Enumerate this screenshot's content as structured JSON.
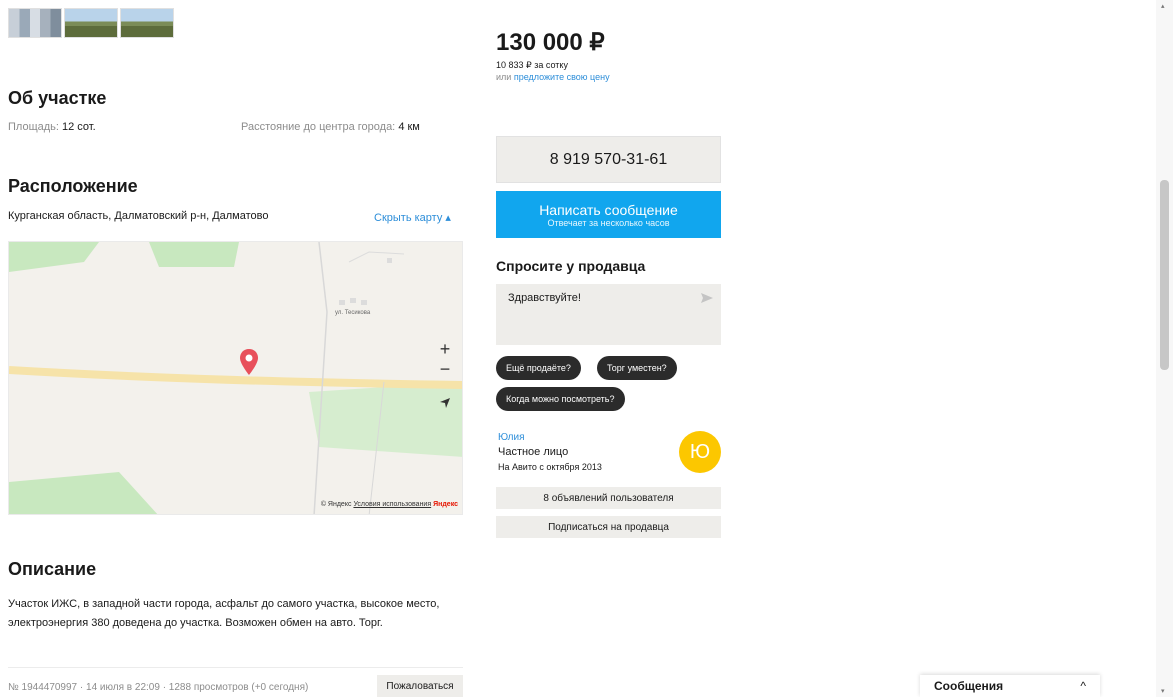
{
  "gallery": {
    "thumbnails": [
      "thumb-1",
      "thumb-2",
      "thumb-3"
    ]
  },
  "about": {
    "title": "Об участке",
    "area_label": "Площадь:",
    "area_value": "12 сот.",
    "distance_label": "Расстояние до центра города:",
    "distance_value": "4 км"
  },
  "location": {
    "title": "Расположение",
    "address": "Курганская область, Далматовский р-н, Далматово",
    "toggle_map": "Скрыть карту ▴",
    "map": {
      "street_label": "ул. Тесикова",
      "copyright": "© Яндекс",
      "terms": "Условия использования",
      "brand": "Яндекс",
      "zoom_in": "+",
      "zoom_out": "−"
    }
  },
  "description": {
    "title": "Описание",
    "line1": "Участок ИЖС, в западной части города, асфальт до самого участка, высокое место,",
    "line2": "электроэнергия 380 доведена до участка. Возможен обмен на авто. Торг."
  },
  "footer": {
    "meta": "№ 1944470997 · 14 июля в 22:09 · 1288 просмотров (+0 сегодня)",
    "report": "Пожаловаться"
  },
  "offer": {
    "price": "130 000 ₽",
    "per_sotka": "10 833 ₽ за сотку",
    "or_text": "или",
    "suggest_price": "предложите свою цену"
  },
  "contact": {
    "phone": "8 919 570-31-61",
    "message_button": "Написать сообщение",
    "message_sub": "Отвечает за несколько часов"
  },
  "ask": {
    "title": "Спросите у продавца",
    "message": "Здравствуйте!",
    "chips": [
      "Ещё продаёте?",
      "Торг уместен?",
      "Когда можно посмотреть?"
    ]
  },
  "seller": {
    "name": "Юлия",
    "type": "Частное лицо",
    "since": "На Авито с октября 2013",
    "avatar_letter": "Ю",
    "listings_button": "8 объявлений пользователя",
    "subscribe_button": "Подписаться на продавца"
  },
  "messages_panel": {
    "label": "Сообщения",
    "chevron": "^"
  },
  "colors": {
    "accent": "#11a6ee",
    "link": "#2d8ed9",
    "avatar": "#fcc700",
    "pin": "#e8505b"
  }
}
